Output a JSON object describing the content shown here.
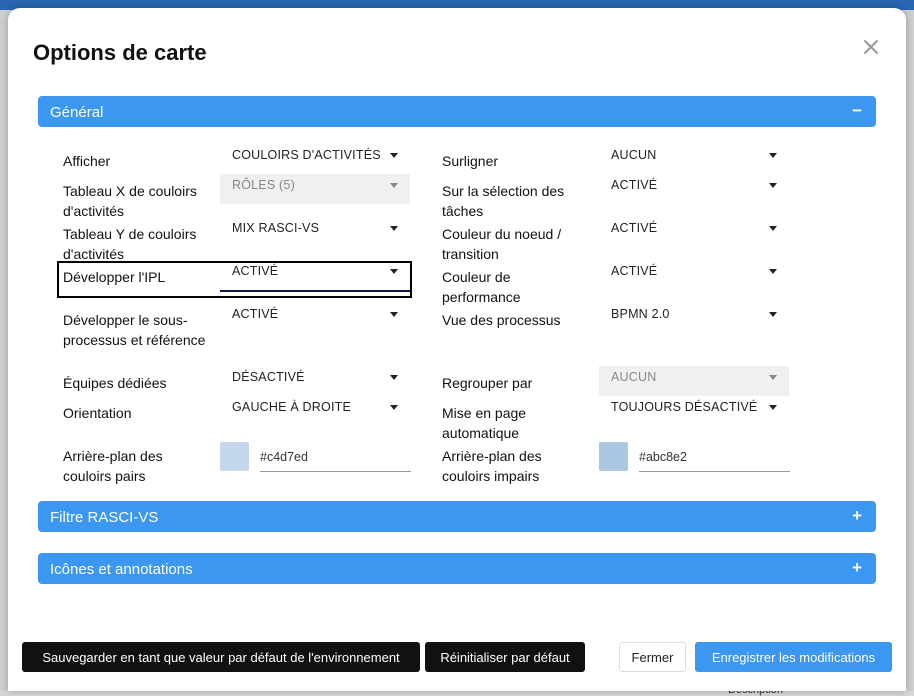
{
  "dialog": {
    "title": "Options de carte"
  },
  "sections": {
    "general": {
      "label": "Général",
      "toggle": "−"
    },
    "rasci": {
      "label": "Filtre RASCI-VS",
      "toggle": "+"
    },
    "icons": {
      "label": "Icônes et annotations",
      "toggle": "+"
    }
  },
  "left_fields": [
    {
      "label": "Afficher",
      "value": "COULOIRS D'ACTIVITÉS",
      "disabled": false
    },
    {
      "label": "Tableau X de couloirs d'activités",
      "value": "RÔLES (5)",
      "disabled": true
    },
    {
      "label": "Tableau Y de couloirs d'activités",
      "value": "MIX RASCI-VS",
      "disabled": false
    },
    {
      "label": "Développer l'IPL",
      "value": "ACTIVÉ",
      "disabled": false,
      "focused": true
    },
    {
      "label": "Développer le sous-processus et référence",
      "value": "ACTIVÉ",
      "disabled": false
    },
    {
      "label": "Équipes dédiées",
      "value": "DÉSACTIVÉ",
      "disabled": false
    },
    {
      "label": "Orientation",
      "value": "GAUCHE À DROITE",
      "disabled": false
    }
  ],
  "right_fields": [
    {
      "label": "Surligner",
      "value": "AUCUN",
      "disabled": false
    },
    {
      "label": "Sur la sélection des tâches",
      "value": "ACTIVÉ",
      "disabled": false
    },
    {
      "label": "Couleur du noeud / transition",
      "value": "ACTIVÉ",
      "disabled": false
    },
    {
      "label": "Couleur de performance",
      "value": "ACTIVÉ",
      "disabled": false
    },
    {
      "label": "Vue des processus",
      "value": "BPMN 2.0",
      "disabled": false
    },
    {
      "label": "Regrouper par",
      "value": "AUCUN",
      "disabled": true
    },
    {
      "label": "Mise en page automatique",
      "value": "TOUJOURS DÉSACTIVÉ",
      "disabled": false
    }
  ],
  "colors": {
    "even": {
      "label": "Arrière-plan des couloirs pairs",
      "value": "#c4d7ed",
      "swatch": "#c4d7ed"
    },
    "odd": {
      "label": "Arrière-plan des couloirs impairs",
      "value": "#abc8e2",
      "swatch": "#abc8e2"
    }
  },
  "footer": {
    "save_default": "Sauvegarder en tant que valeur par défaut de l'environnement",
    "reset": "Réinitialiser par défaut",
    "close": "Fermer",
    "save": "Enregistrer les modifications"
  },
  "background": {
    "cell1": "Description",
    "accent": "#3c97f0"
  }
}
